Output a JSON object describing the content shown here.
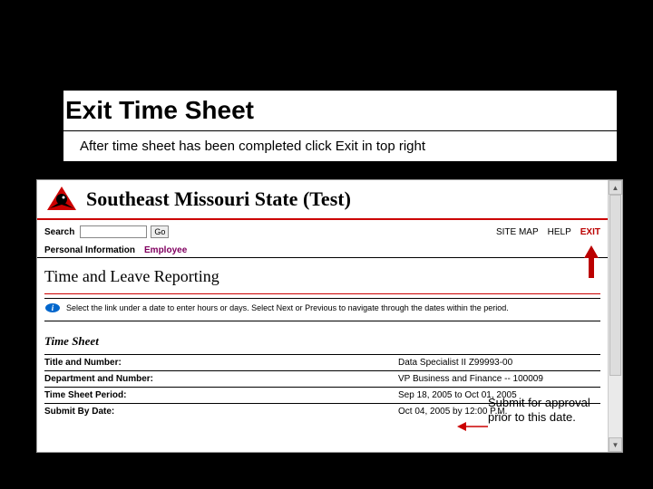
{
  "slide": {
    "title": "Exit Time Sheet",
    "subtitle": "After time sheet has been completed click Exit in top right"
  },
  "banner": {
    "title": "Southeast Missouri State (Test)"
  },
  "toprow": {
    "search_label": "Search",
    "go_label": "Go",
    "sitemap": "SITE MAP",
    "help": "HELP",
    "exit": "EXIT"
  },
  "tabs": {
    "personal": "Personal Information",
    "employee": "Employee"
  },
  "section": {
    "title": "Time and Leave Reporting"
  },
  "info": {
    "text": "Select the link under a date to enter hours or days. Select Next or Previous to navigate through the dates within the period."
  },
  "ts": {
    "label": "Time Sheet"
  },
  "rows": [
    {
      "label": "Title and Number:",
      "value": "Data Specialist II    Z99993-00"
    },
    {
      "label": "Department and Number:",
      "value": "VP Business and Finance -- 100009"
    },
    {
      "label": "Time Sheet Period:",
      "value": "Sep 18, 2005 to Oct 01, 2005"
    },
    {
      "label": "Submit By Date:",
      "value": "Oct 04, 2005 by 12:00 P.M."
    }
  ],
  "callout": {
    "text": "Submit for approval prior to this date."
  }
}
